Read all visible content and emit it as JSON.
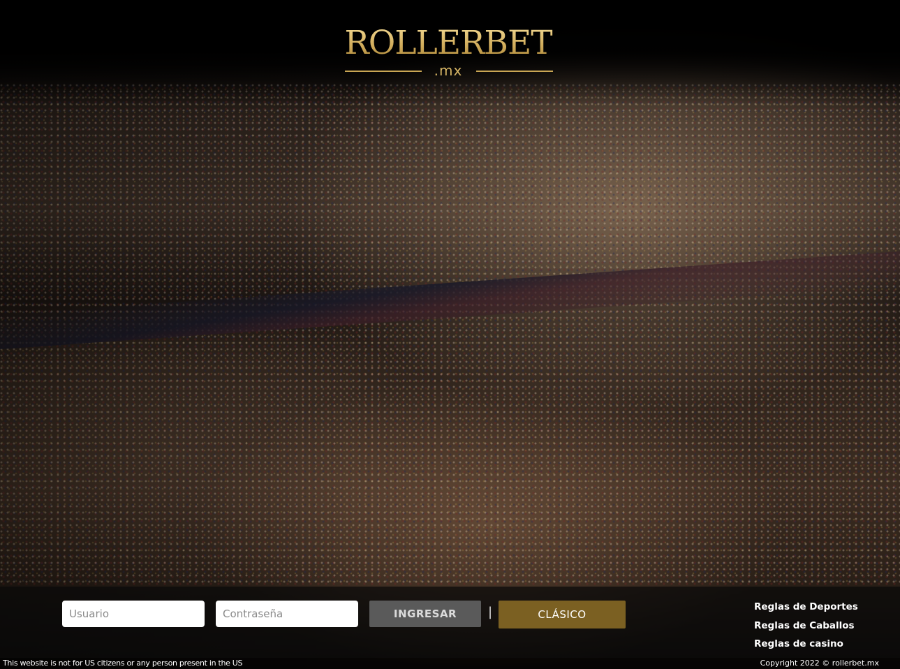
{
  "brand": {
    "name": "ROLLERBET",
    "domain": ".mx",
    "accent_color": "#c9a654"
  },
  "login": {
    "username_placeholder": "Usuario",
    "password_placeholder": "Contraseña",
    "login_label": "INGRESAR",
    "separator": "|",
    "classic_label": "CLÁSICO",
    "login_button_color": "#5a5a5a",
    "classic_button_color": "#7b6022"
  },
  "links": [
    {
      "label": "Reglas de Deportes"
    },
    {
      "label": "Reglas de Caballos"
    },
    {
      "label": "Reglas de casino"
    }
  ],
  "footer": {
    "disclaimer": "This website is not for US citizens or any person present in the US",
    "copyright": "Copyright 2022 © rollerbet.mx"
  }
}
